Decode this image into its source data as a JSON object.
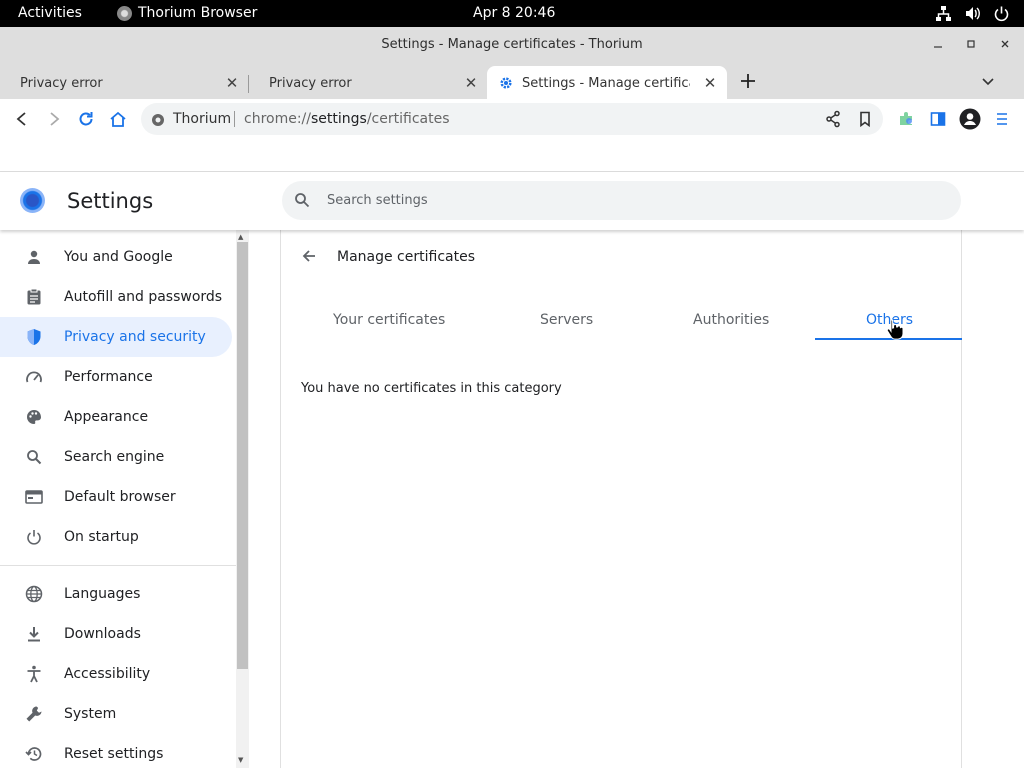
{
  "topbar": {
    "activities": "Activities",
    "app_name": "Thorium Browser",
    "clock": "Apr 8  20:46",
    "tray_icons": [
      "network-icon",
      "volume-icon",
      "power-icon"
    ]
  },
  "window": {
    "title": "Settings - Manage certificates - Thorium",
    "controls": [
      "minimize",
      "maximize",
      "close"
    ]
  },
  "tabs": [
    {
      "label": "Privacy error",
      "active": false
    },
    {
      "label": "Privacy error",
      "active": false
    },
    {
      "label": "Settings - Manage certificate",
      "active": true
    }
  ],
  "toolbar": {
    "site_name": "Thorium",
    "url_scheme": "chrome://",
    "url_host": "settings",
    "url_path": "/certificates"
  },
  "settings": {
    "title": "Settings",
    "search_placeholder": "Search settings"
  },
  "sidebar": {
    "items": [
      {
        "label": "You and Google",
        "icon": "person-icon",
        "active": false
      },
      {
        "label": "Autofill and passwords",
        "icon": "clipboard-icon",
        "active": false
      },
      {
        "label": "Privacy and security",
        "icon": "shield-icon",
        "active": true
      },
      {
        "label": "Performance",
        "icon": "speedometer-icon",
        "active": false
      },
      {
        "label": "Appearance",
        "icon": "palette-icon",
        "active": false
      },
      {
        "label": "Search engine",
        "icon": "search-icon",
        "active": false
      },
      {
        "label": "Default browser",
        "icon": "browser-icon",
        "active": false
      },
      {
        "label": "On startup",
        "icon": "power-icon",
        "active": false
      },
      {
        "label": "Languages",
        "icon": "globe-icon",
        "active": false
      },
      {
        "label": "Downloads",
        "icon": "download-icon",
        "active": false
      },
      {
        "label": "Accessibility",
        "icon": "accessibility-icon",
        "active": false
      },
      {
        "label": "System",
        "icon": "wrench-icon",
        "active": false
      },
      {
        "label": "Reset settings",
        "icon": "history-icon",
        "active": false
      }
    ]
  },
  "certificates": {
    "title": "Manage certificates",
    "tabs": [
      "Your certificates",
      "Servers",
      "Authorities",
      "Others"
    ],
    "active_tab": "Others",
    "empty_message": "You have no certificates in this category"
  },
  "colors": {
    "accent": "#1a73e8",
    "active_nav_bg": "#e8f0fe"
  }
}
